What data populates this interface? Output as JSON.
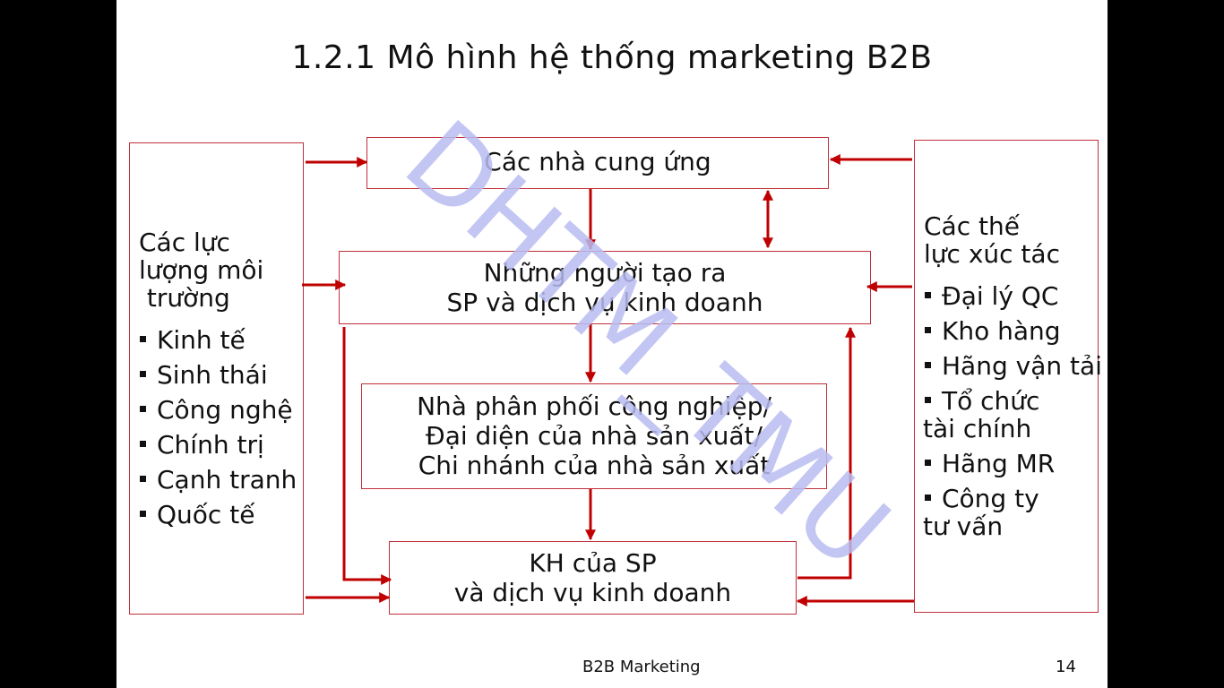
{
  "slide": {
    "title": "1.2.1 Mô hình hệ thống marketing B2B",
    "watermark": "DHTM_TMU",
    "footer": "B2B Marketing",
    "page_number": "14",
    "colors": {
      "border": "#c0303a",
      "arrow": "#c00000",
      "watermark": "#b8bcf0"
    }
  },
  "left_panel": {
    "heading_lines": [
      "Các lực",
      "lượng môi",
      " trường"
    ],
    "items": [
      "Kinh tế",
      "Sinh thái",
      "Công nghệ",
      "Chính trị",
      "Cạnh tranh",
      "Quốc tế"
    ]
  },
  "right_panel": {
    "heading_lines": [
      "Các thế",
      "lực xúc tác"
    ],
    "items": [
      {
        "lines": [
          "Đại lý QC"
        ]
      },
      {
        "lines": [
          "Kho hàng"
        ]
      },
      {
        "lines": [
          "Hãng vận tải"
        ]
      },
      {
        "lines": [
          "Tổ chức",
          "tài chính"
        ]
      },
      {
        "lines": [
          "Hãng MR"
        ]
      },
      {
        "lines": [
          "Công ty",
          "tư vấn"
        ]
      }
    ]
  },
  "boxes": {
    "suppliers": {
      "lines": [
        "Các nhà cung ứng"
      ]
    },
    "producers": {
      "lines": [
        "Những người tạo ra",
        "SP và dịch vụ kinh doanh"
      ]
    },
    "distributors": {
      "lines": [
        "Nhà phân phối công nghiệp/",
        "Đại diện của nhà sản xuất/",
        "Chi nhánh của nhà sản xuất"
      ]
    },
    "customers": {
      "lines": [
        "KH của SP",
        "và dịch vụ kinh doanh"
      ]
    }
  }
}
